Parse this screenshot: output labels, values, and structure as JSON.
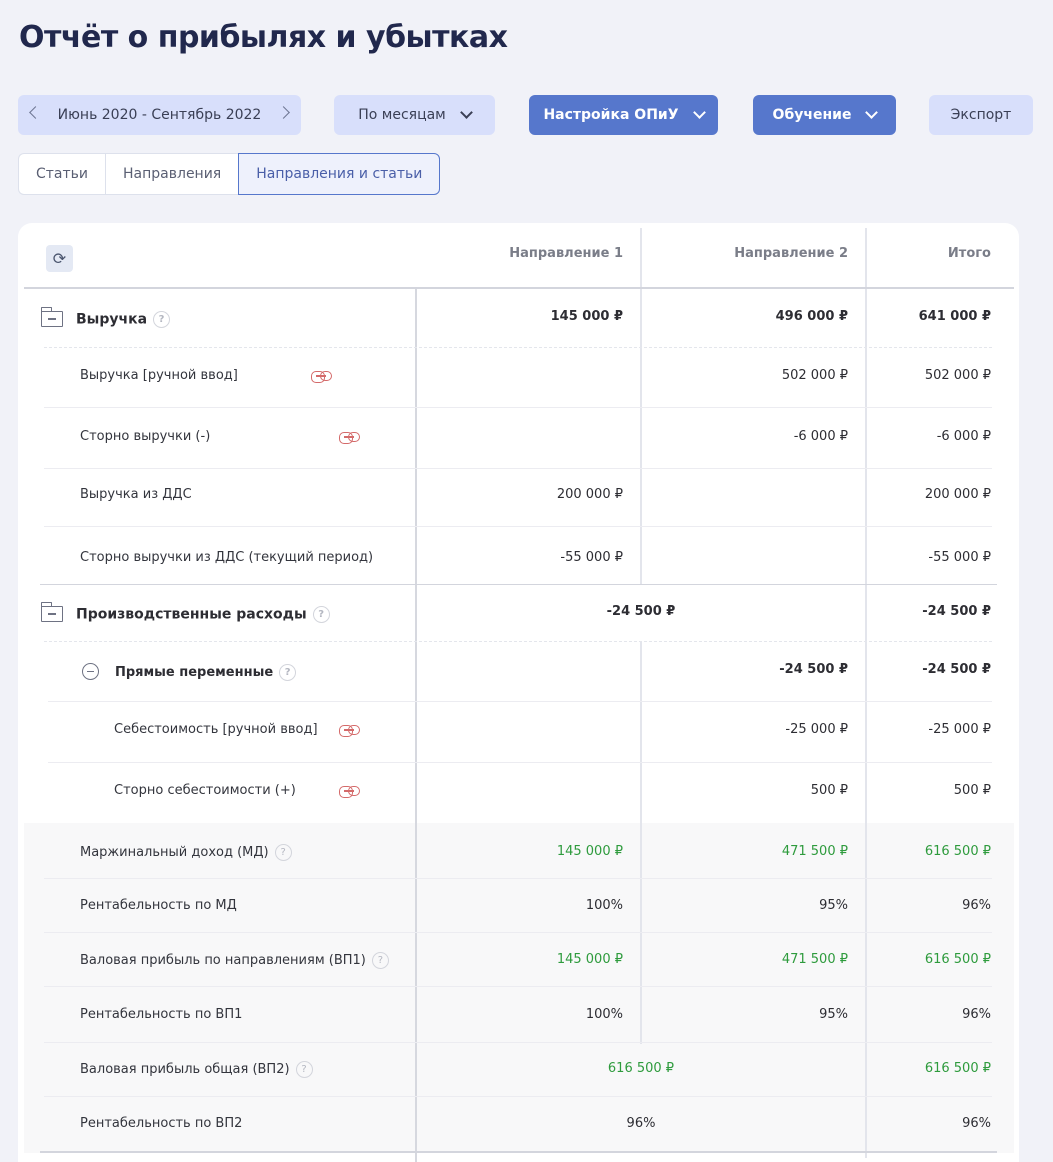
{
  "page": {
    "title": "Отчёт о прибылях и убытках"
  },
  "toolbar": {
    "period": "Июнь 2020 - Сентябрь 2022",
    "grouping": "По месяцам",
    "settings": "Настройка ОПиУ",
    "training": "Обучение",
    "export": "Экспорт"
  },
  "tabs": [
    "Статьи",
    "Направления",
    "Направления и статьи"
  ],
  "table": {
    "columns": [
      "Направление 1",
      "Направление 2",
      "Итого"
    ],
    "revenue": {
      "label": "Выручка",
      "values": [
        "145 000 ₽",
        "496 000 ₽",
        "641 000 ₽"
      ],
      "rows": [
        {
          "label": "Выручка [ручной ввод]",
          "values": [
            "",
            "502 000 ₽",
            "502 000 ₽"
          ]
        },
        {
          "label": "Сторно выручки (-)",
          "values": [
            "",
            "-6 000 ₽",
            "-6 000 ₽"
          ]
        },
        {
          "label": "Выручка из ДДС",
          "values": [
            "200 000 ₽",
            "",
            "200 000 ₽"
          ]
        },
        {
          "label": "Сторно выручки из ДДС (текущий период)",
          "values": [
            "-55 000 ₽",
            "",
            "-55 000 ₽"
          ]
        }
      ]
    },
    "production": {
      "label": "Производственные расходы",
      "merged": "-24 500 ₽",
      "total": "-24 500 ₽",
      "sub": {
        "label": "Прямые переменные",
        "values": [
          "",
          "-24 500 ₽",
          "-24 500 ₽"
        ],
        "rows": [
          {
            "label": "Себестоимость [ручной ввод]",
            "values": [
              "",
              "-25 000 ₽",
              "-25 000 ₽"
            ]
          },
          {
            "label": "Сторно себестоимости (+)",
            "values": [
              "",
              "500 ₽",
              "500 ₽"
            ]
          }
        ]
      }
    },
    "metrics": [
      {
        "label": "Маржинальный доход (МД)",
        "values": [
          "145 000 ₽",
          "471 500 ₽",
          "616 500 ₽"
        ]
      },
      {
        "label": "Рентабельность по МД",
        "values": [
          "100%",
          "95%",
          "96%"
        ]
      },
      {
        "label": "Валовая прибыль по направлениям (ВП1)",
        "values": [
          "145 000 ₽",
          "471 500 ₽",
          "616 500 ₽"
        ]
      },
      {
        "label": "Рентабельность по ВП1",
        "values": [
          "100%",
          "95%",
          "96%"
        ]
      },
      {
        "label": "Валовая прибыль общая (ВП2)",
        "merged": "616 500 ₽",
        "total": "616 500 ₽"
      },
      {
        "label": "Рентабельность по ВП2",
        "merged": "96%",
        "total": "96%"
      }
    ]
  }
}
